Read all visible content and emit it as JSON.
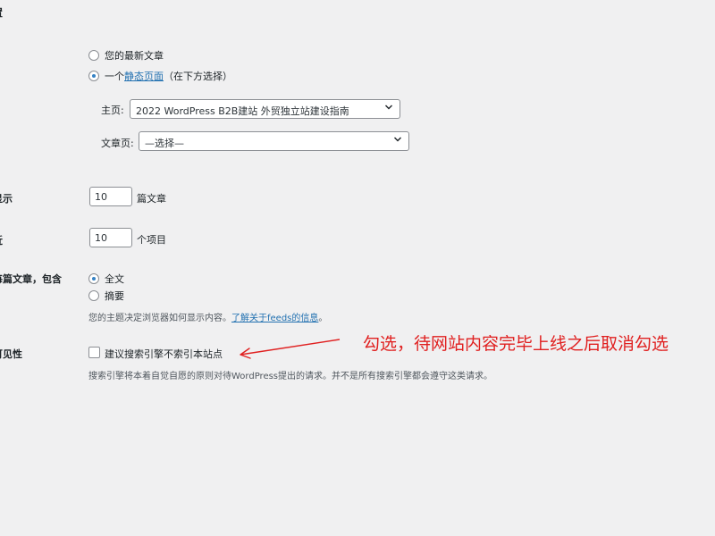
{
  "top_fragment": "置",
  "front_page": {
    "option_latest": "您的最新文章",
    "option_static_prefix": "一个",
    "option_static_link": "静态页面",
    "option_static_suffix": "（在下方选择）",
    "homepage_label": "主页:",
    "homepage_value": "2022 WordPress B2B建站 外贸独立站建设指南",
    "posts_page_label": "文章页:",
    "posts_page_value": "—选择—"
  },
  "blog_pages": {
    "label": "显示",
    "value": "10",
    "unit": "篇文章"
  },
  "feed_items": {
    "label": "近",
    "value": "10",
    "unit": "个项目"
  },
  "feed_content": {
    "label": "每篇文章，包含",
    "option_full": "全文",
    "option_summary": "摘要",
    "desc_prefix": "您的主题决定浏览器如何显示内容。",
    "desc_link": "了解关于feeds的信息",
    "desc_suffix": "。"
  },
  "visibility": {
    "label": "可见性",
    "checkbox_label": "建议搜索引擎不索引本站点",
    "desc": "搜索引擎将本着自觉自愿的原则对待WordPress提出的请求。并不是所有搜索引擎都会遵守这类请求。"
  },
  "annotation": {
    "text": "勾选，待网站内容完毕上线之后取消勾选",
    "color": "#e02020"
  }
}
